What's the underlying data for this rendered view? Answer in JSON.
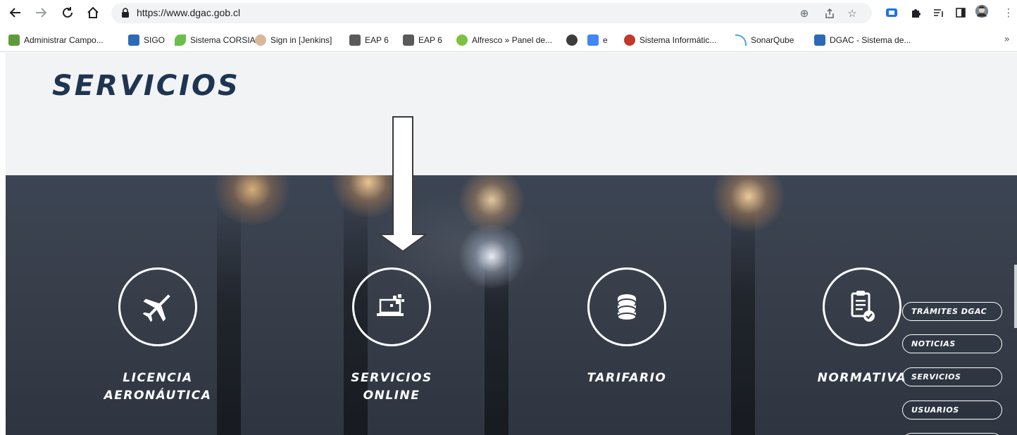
{
  "browser": {
    "url": "https://www.dgac.gob.cl",
    "bookmarks": [
      {
        "label": "Administrar Campo..."
      },
      {
        "label": "SIGO"
      },
      {
        "label": "Sistema CORSIA"
      },
      {
        "label": "Sign in [Jenkins]"
      },
      {
        "label": "EAP 6"
      },
      {
        "label": "EAP 6"
      },
      {
        "label": "Alfresco » Panel de..."
      },
      {
        "label": ""
      },
      {
        "label": "e"
      },
      {
        "label": "Sistema Informátic..."
      },
      {
        "label": "SonarQube"
      },
      {
        "label": "DGAC - Sistema de..."
      }
    ],
    "more_label": "»"
  },
  "page": {
    "title": "SERVICIOS",
    "services": [
      {
        "label": "LICENCIA\nAERONÁUTICA",
        "icon": "airplane-icon"
      },
      {
        "label": "SERVICIOS\nONLINE",
        "icon": "laptop-icon"
      },
      {
        "label": "TARIFARIO",
        "icon": "coins-icon"
      },
      {
        "label": "NORMATIVA",
        "icon": "clipboard-check-icon"
      }
    ],
    "side_menu": [
      {
        "label": "TRÁMITES DGAC"
      },
      {
        "label": "NOTICIAS"
      },
      {
        "label": "SERVICIOS"
      },
      {
        "label": "USUARIOS"
      }
    ]
  },
  "colors": {
    "title": "#1e3552",
    "hero_bg": "#39404c",
    "header_bg": "#f2f3f5"
  }
}
